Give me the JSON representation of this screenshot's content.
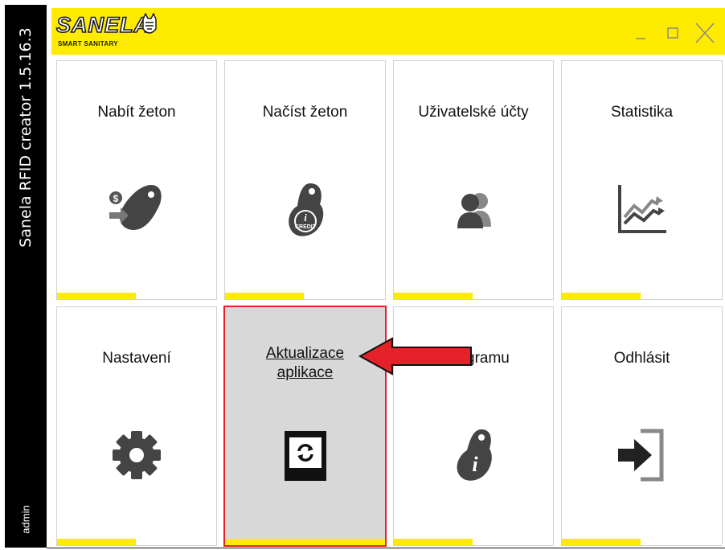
{
  "app": {
    "title": "Sanela RFID creator 1.5.16.3",
    "user": "admin"
  },
  "brand": {
    "logo": "SANELA",
    "tagline": "SMART SANITARY",
    "accent": "#ffeb00",
    "highlight": "#e52229"
  },
  "window_controls": {
    "minimize": "minimize-icon",
    "maximize": "maximize-icon",
    "close": "close-icon"
  },
  "tiles": [
    {
      "label": "Nabít žeton",
      "icon": "charge-token-icon"
    },
    {
      "label": "Načíst žeton",
      "icon": "read-token-icon",
      "icon_text": "CREDIT"
    },
    {
      "label": "Uživatelské účty",
      "icon": "users-icon"
    },
    {
      "label": "Statistika",
      "icon": "statistics-icon"
    },
    {
      "label": "Nastavení",
      "icon": "gear-icon"
    },
    {
      "label_line1": "Aktualizace",
      "label_line2": "aplikace",
      "icon": "update-icon",
      "selected": true
    },
    {
      "label": "gramu",
      "icon": "info-token-icon"
    },
    {
      "label": "Odhlásit",
      "icon": "logout-icon"
    }
  ]
}
